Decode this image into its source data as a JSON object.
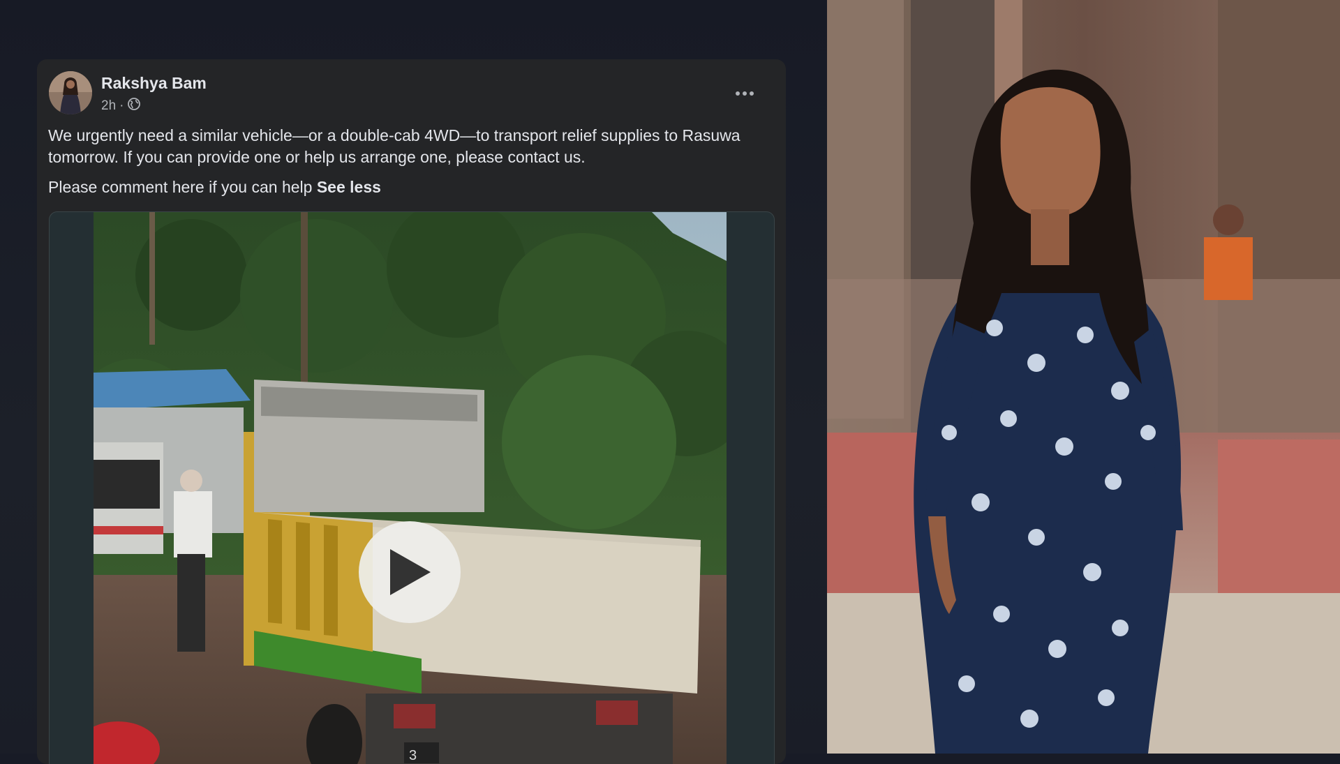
{
  "post": {
    "author": "Rakshya Bam",
    "time": "2h",
    "privacy_icon": "globe-icon",
    "more_icon": "more-horizontal-icon",
    "body": "We urgently need a similar vehicle—or a double-cab 4WD—to transport relief supplies to Rasuwa tomorrow. If you can provide one or help us arrange one, please contact us.",
    "body_second": "Please comment here if you can help",
    "see_less": "See less",
    "video": {
      "play_icon": "play-icon",
      "plate_text": "3"
    }
  },
  "colors": {
    "page_bg": "#181b26",
    "card_bg": "#242527",
    "text_primary": "#e4e6eb",
    "text_secondary": "#b0b3b8",
    "truck_yellow": "#c9a233",
    "truck_green": "#3e8a2c"
  }
}
